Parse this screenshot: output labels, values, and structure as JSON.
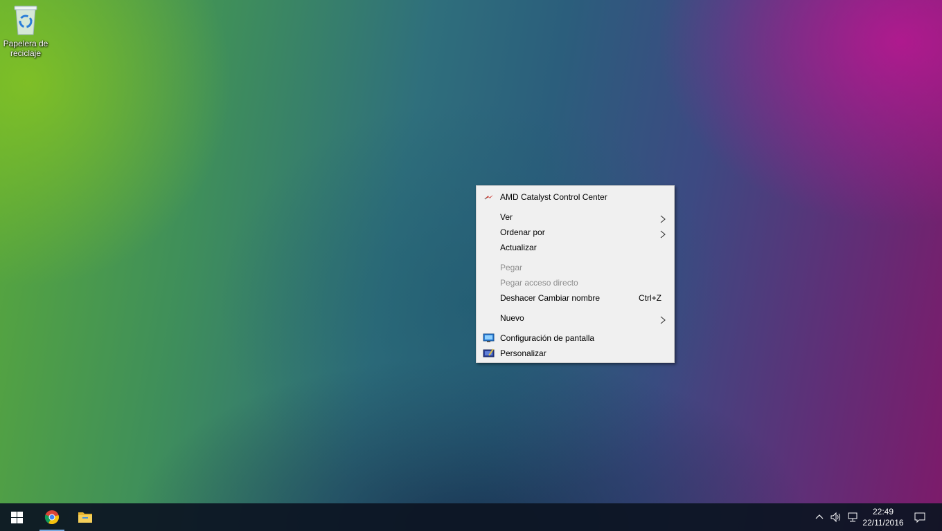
{
  "desktop": {
    "recycle_bin_label": "Papelera de reciclaje"
  },
  "context_menu": {
    "items": [
      {
        "label": "AMD Catalyst Control Center",
        "icon": "amd-catalyst-icon"
      },
      {
        "label": "Ver",
        "submenu": true
      },
      {
        "label": "Ordenar por",
        "submenu": true
      },
      {
        "label": "Actualizar"
      },
      {
        "label": "Pegar",
        "disabled": true
      },
      {
        "label": "Pegar acceso directo",
        "disabled": true
      },
      {
        "label": "Deshacer Cambiar nombre",
        "shortcut": "Ctrl+Z"
      },
      {
        "label": "Nuevo",
        "submenu": true
      },
      {
        "label": "Configuración de pantalla",
        "icon": "display-settings-icon"
      },
      {
        "label": "Personalizar",
        "icon": "personalize-icon"
      }
    ]
  },
  "taskbar": {
    "pinned": [
      "start-button",
      "chrome",
      "file-explorer"
    ],
    "clock_time": "22:49",
    "clock_date": "22/11/2016"
  },
  "colors": {
    "accent_underline": "#79a9de",
    "menu_bg": "#f0f0f0",
    "disabled_text": "#8d8d8d"
  }
}
